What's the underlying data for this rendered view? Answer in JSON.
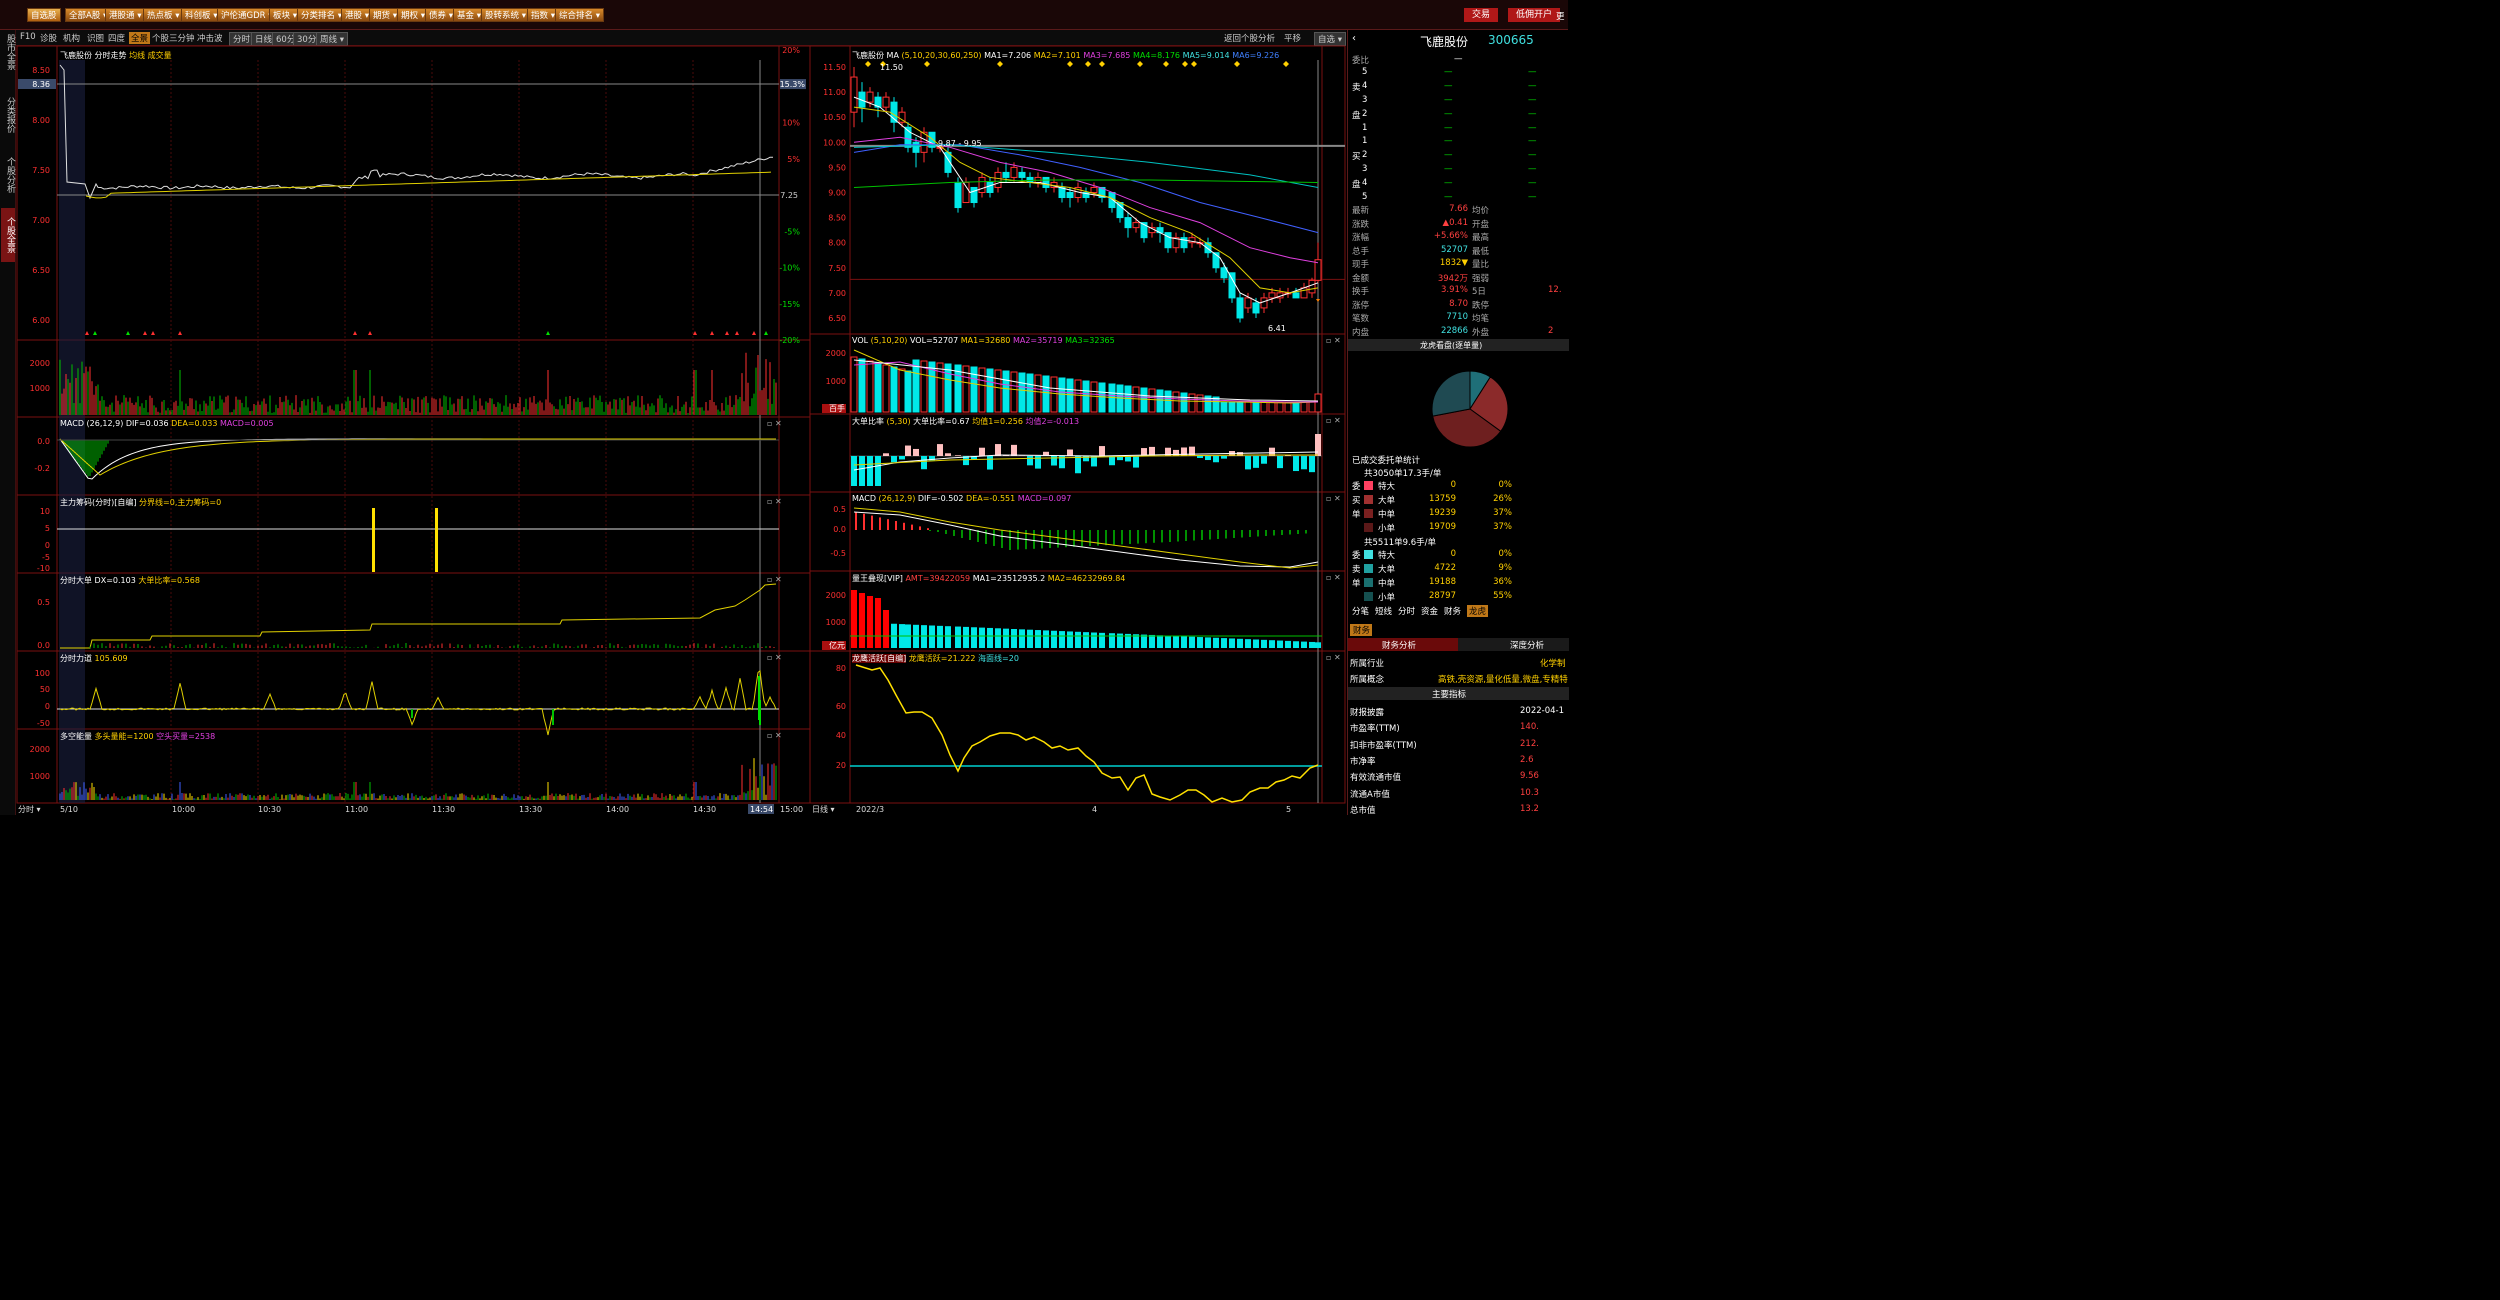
{
  "top_menu": [
    "自选股",
    "全部A股",
    "港股通",
    "热点板",
    "科创板",
    "沪伦通GDR",
    "板块",
    "分类排名",
    "港股",
    "期货",
    "期权",
    "债券",
    "基金",
    "股转系统",
    "指数",
    "综合排名"
  ],
  "top_right": {
    "trade": "交易",
    "open_account": "低佣开户",
    "more": "更"
  },
  "left_rail": [
    "股市全景",
    "分类报价",
    "个股分析",
    "个股全景"
  ],
  "subbar": {
    "items": [
      "F10",
      "诊股",
      "机构",
      "识图",
      "四度",
      "全景",
      "个股三分钟",
      "冲击波",
      "分时",
      "日线",
      "60分",
      "30分",
      "周线"
    ],
    "right": [
      "返回个股分析",
      "平移",
      "自选"
    ]
  },
  "intraday": {
    "title": "飞鹿股份",
    "subtitle": "分时走势",
    "legend": "均线 成交量",
    "price_ticks": [
      "8.50",
      "8.36",
      "8.00",
      "7.50",
      "7.25",
      "7.00",
      "6.50",
      "6.00"
    ],
    "pct_ticks": [
      "20%",
      "15.3%",
      "10%",
      "5%",
      "0%",
      "-5%",
      "-10%",
      "-15%",
      "-20%"
    ],
    "time_ticks": [
      "分时",
      "5/10",
      "10:00",
      "10:30",
      "11:00",
      "11:30",
      "13:30",
      "14:00",
      "14:30",
      "14:54",
      "15:00"
    ],
    "vol_ticks": [
      "2000",
      "1000"
    ],
    "macd": {
      "name": "MACD",
      "params": "(26,12,9)",
      "dif": "DIF=0.036",
      "dea": "DEA=0.033",
      "macd": "MACD=0.005",
      "ticks": [
        "0.0",
        "-0.2"
      ]
    },
    "zhuli": {
      "name": "主力筹码(分时)[自编]",
      "text": "分界线=0,主力筹码=0",
      "ticks": [
        "10",
        "5",
        "0",
        "-5",
        "-10"
      ]
    },
    "dadan": {
      "name": "分时大单",
      "text": "DX=0.103",
      "text2": "大单比率=0.568",
      "ticks": [
        "0.5",
        "0.0"
      ]
    },
    "lidao": {
      "name": "分时力道",
      "text": "105.609",
      "ticks": [
        "100",
        "50",
        "0",
        "-50"
      ]
    },
    "duokong": {
      "name": "多空能量",
      "text": "多头量能=1200",
      "text2": "空头买量=2538",
      "ticks": [
        "2000",
        "1000"
      ]
    }
  },
  "kline": {
    "title": "飞鹿股份",
    "ma_label": "MA",
    "ma_params": "(5,10,20,30,60,250)",
    "ma_values": [
      "MA1=7.206",
      "MA2=7.101",
      "MA3=7.685",
      "MA4=8.176",
      "MA5=9.014",
      "MA6=9.226"
    ],
    "price_ticks": [
      "11.50",
      "11.00",
      "10.50",
      "10.00",
      "9.50",
      "9.00",
      "8.50",
      "8.00",
      "7.50",
      "7.00",
      "6.50"
    ],
    "annotations": {
      "high": "11.50",
      "range": "9.87 - 9.95",
      "low": "6.41"
    },
    "date_ticks": [
      "日线",
      "2022/3",
      "4",
      "5"
    ],
    "vol": {
      "name": "VOL",
      "params": "(5,10,20)",
      "vals": [
        "VOL=52707",
        "MA1=32680",
        "MA2=35719",
        "MA3=32365"
      ],
      "ticks": [
        "2000",
        "1000",
        "百手"
      ]
    },
    "dadan": {
      "name": "大单比率",
      "params": "(5,30)",
      "vals": [
        "大单比率=0.67",
        "均值1=0.256",
        "均值2=-0.013"
      ]
    },
    "macd": {
      "name": "MACD",
      "params": "(26,12,9)",
      "vals": [
        "DIF=-0.502",
        "DEA=-0.551",
        "MACD=0.097"
      ],
      "ticks": [
        "0.5",
        "0.0",
        "-0.5"
      ]
    },
    "liangwang": {
      "name": "量王叠现[VIP]",
      "vals": [
        "AMT=39422059",
        "MA1=23512935.2",
        "MA2=46232969.84"
      ],
      "ticks": [
        "2000",
        "1000",
        "亿元"
      ]
    },
    "longying": {
      "name": "龙鹰活跃[自编]",
      "vals": [
        "龙鹰活跃=21.222",
        "海面线=20"
      ],
      "ticks": [
        "80",
        "60",
        "40",
        "20"
      ]
    }
  },
  "quote": {
    "name": "飞鹿股份",
    "code": "300665",
    "weibi": "委比",
    "weibi_val": "—",
    "sell_label": "卖",
    "buy_label": "买",
    "pan": "盘",
    "sell_levels": [
      "5",
      "4",
      "3",
      "2",
      "1"
    ],
    "buy_levels": [
      "1",
      "2",
      "3",
      "4",
      "5"
    ],
    "stats": [
      [
        "最新",
        "7.66",
        "均价",
        ""
      ],
      [
        "涨跌",
        "▲0.41",
        "开盘",
        ""
      ],
      [
        "涨幅",
        "+5.66%",
        "最高",
        ""
      ],
      [
        "总手",
        "52707",
        "最低",
        ""
      ],
      [
        "现手",
        "1832▼",
        "量比",
        ""
      ],
      [
        "金额",
        "3942万",
        "强弱",
        ""
      ],
      [
        "换手",
        "3.91%",
        "5日",
        "12."
      ],
      [
        "涨停",
        "8.70",
        "跌停",
        ""
      ],
      [
        "笔数",
        "7710",
        "均笔",
        ""
      ],
      [
        "内盘",
        "22866",
        "外盘",
        "2"
      ]
    ],
    "chart_title": "龙虎看盘(逐单量)",
    "pie": [
      {
        "label": "特大买",
        "value": 9,
        "color": "#1f6f78"
      },
      {
        "label": "大单买",
        "value": 26,
        "color": "#8b2a2a"
      },
      {
        "label": "中单买",
        "value": 37,
        "color": "#6e1f1f"
      },
      {
        "label": "小单",
        "value": 28,
        "color": "#1f4a52"
      }
    ],
    "deal_title": "已成交委托单统计",
    "buy_header": "共3050单17.3手/单",
    "buy_rows": [
      [
        "特大",
        "0",
        "0%"
      ],
      [
        "大单",
        "13759",
        "26%"
      ],
      [
        "中单",
        "19239",
        "37%"
      ],
      [
        "小单",
        "19709",
        "37%"
      ]
    ],
    "buy_side": [
      "委",
      "买",
      "单"
    ],
    "sell_header": "共5511单9.6手/单",
    "sell_rows": [
      [
        "特大",
        "0",
        "0%"
      ],
      [
        "大单",
        "4722",
        "9%"
      ],
      [
        "中单",
        "19188",
        "36%"
      ],
      [
        "小单",
        "28797",
        "55%"
      ]
    ],
    "sell_side": [
      "委",
      "卖",
      "单"
    ],
    "tabs": [
      "分笔",
      "短线",
      "分时",
      "资金",
      "财务",
      "龙虎"
    ],
    "fin_tab": "财务",
    "fin_left": "财务分析",
    "fin_right": "深度分析",
    "industry": [
      "所属行业",
      "化学制"
    ],
    "concept": [
      "所属概念",
      "高铁,壳资源,量化低量,微盘,专精特"
    ],
    "main_idx": "主要指标",
    "indicators": [
      [
        "财报披露",
        "2022-04-1"
      ],
      [
        "市盈率(TTM)",
        "140."
      ],
      [
        "扣非市盈率(TTM)",
        "212."
      ],
      [
        "市净率",
        "2.6"
      ],
      [
        "有效流通市值",
        "9.56"
      ],
      [
        "流通A市值",
        "10.3"
      ],
      [
        "总市值",
        "13.2"
      ]
    ]
  }
}
